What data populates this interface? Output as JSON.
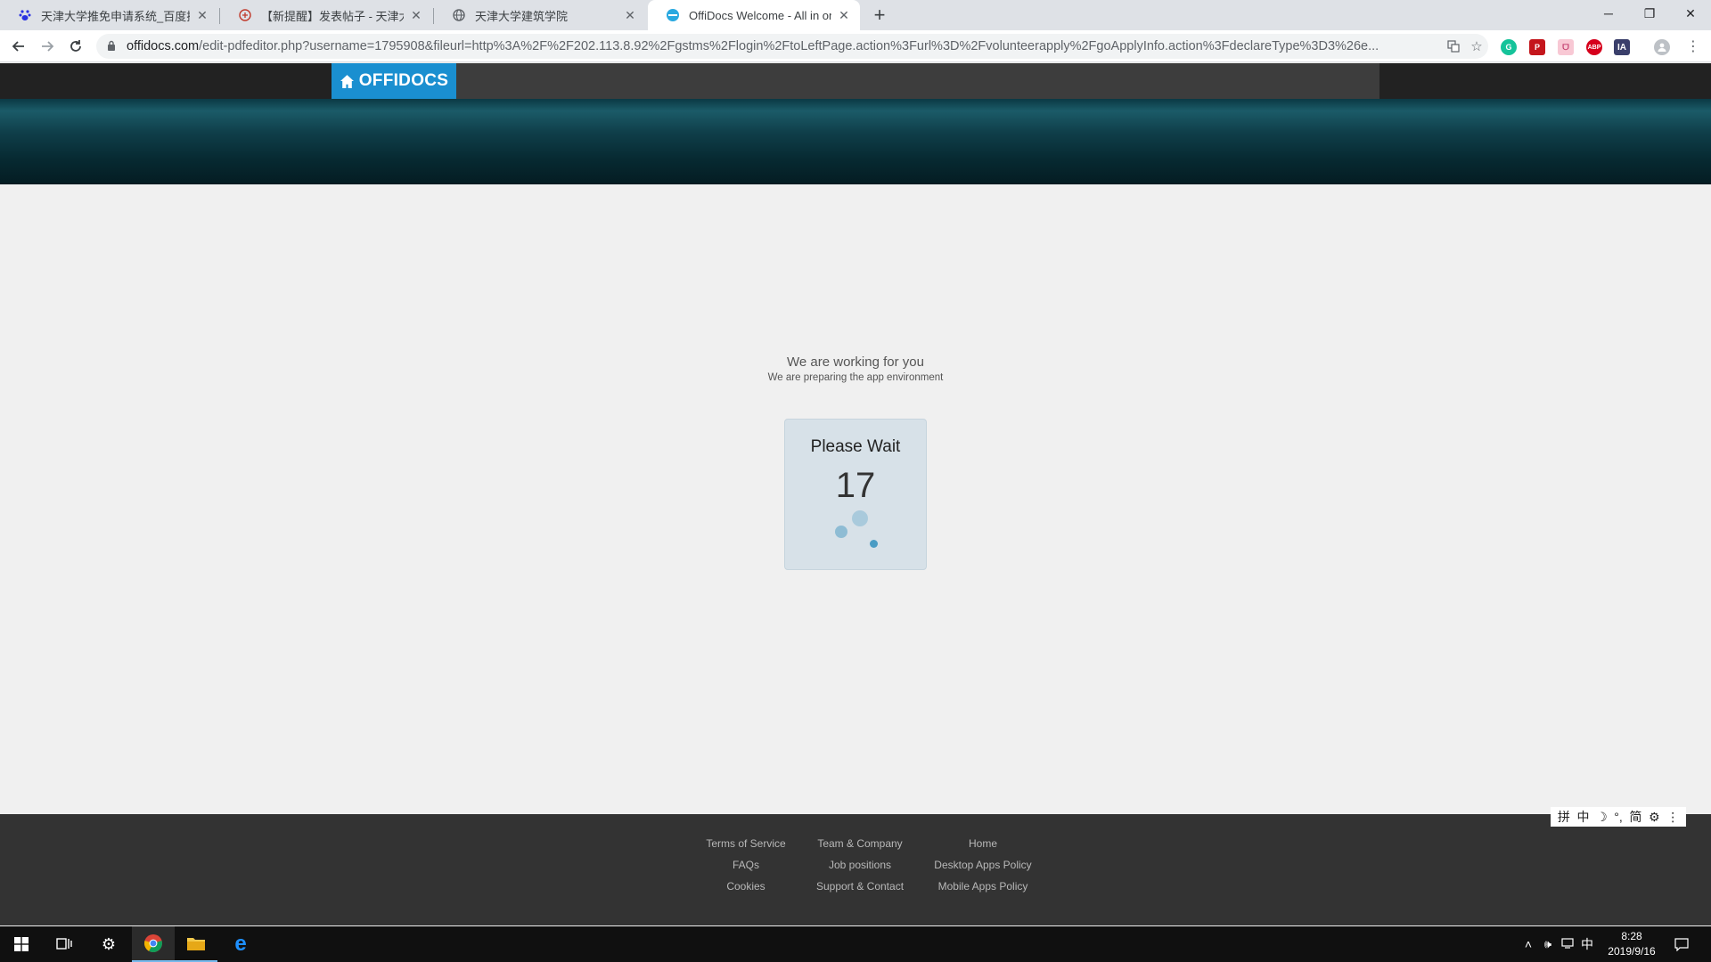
{
  "browser": {
    "tabs": [
      {
        "title": "天津大学推免申请系统_百度搜索",
        "favicon": "baidu-paw-icon",
        "active": false
      },
      {
        "title": "【新提醒】发表帖子 - 天津大学",
        "favicon": "forum-icon",
        "active": false
      },
      {
        "title": "天津大学建筑学院",
        "favicon": "globe-icon",
        "active": false
      },
      {
        "title": "OffiDocs Welcome - All in one",
        "favicon": "offidocs-icon",
        "active": true
      }
    ],
    "new_tab": "+",
    "window_controls": {
      "minimize": "─",
      "restore": "❐",
      "close": "✕"
    },
    "url_domain": "offidocs.com",
    "url_rest": "/edit-pdfeditor.php?username=1795908&fileurl=http%3A%2F%2F202.113.8.92%2Fgstms%2Flogin%2FtoLeftPage.action%3Furl%3D%2Fvolunteerapply%2FgoApplyInfo.action%3FdeclareType%3D3%26e..."
  },
  "site": {
    "logo_text": "OFFIDOCS",
    "brand_color": "#1a8fd0"
  },
  "loading": {
    "headline": "We are working for you",
    "subline": "We are preparing the app environment",
    "box_title": "Please Wait",
    "countdown": "17"
  },
  "footer": {
    "col1": [
      "Terms of Service",
      "FAQs",
      "Cookies"
    ],
    "col2": [
      "Team & Company",
      "Job positions",
      "Support & Contact"
    ],
    "col3": [
      "Home",
      "Desktop Apps Policy",
      "Mobile Apps Policy"
    ]
  },
  "ime_bar": [
    "拼",
    "中",
    "☽",
    "°,",
    "简",
    "⚙",
    "⋮"
  ],
  "taskbar": {
    "tray_lang": "中",
    "time": "8:28",
    "date": "2019/9/16"
  }
}
